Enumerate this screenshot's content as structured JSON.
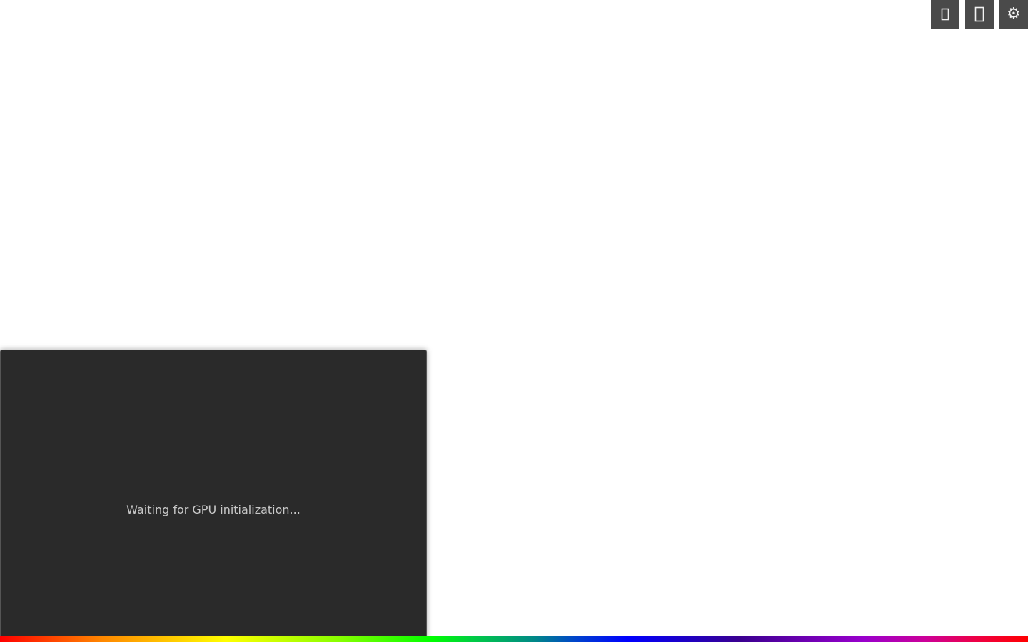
{
  "toolbar": {
    "buttons": [
      {
        "icon": "small-rectangle-icon",
        "label": ""
      },
      {
        "icon": "large-rectangle-icon",
        "label": ""
      },
      {
        "icon": "gear-icon",
        "label": "⚙"
      }
    ]
  },
  "gpu_panel": {
    "status_text": "Waiting for GPU initialization..."
  },
  "colors": {
    "panel_background": "#2a2a2a",
    "toolbar_button": "#4a4a4a",
    "status_text": "#c8c8c8",
    "page_background": "#ffffff"
  }
}
